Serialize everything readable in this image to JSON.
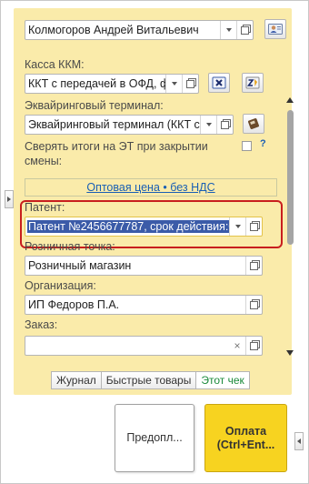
{
  "cashier": {
    "value": "Колмогоров Андрей Витальевич"
  },
  "kkm": {
    "label": "Касса ККМ:",
    "value": "ККТ с передачей в ОФД, фи"
  },
  "acquiring": {
    "label": "Эквайринговый терминал:",
    "value": "Эквайринговый терминал  (ККТ с"
  },
  "reconcile": {
    "label_line1": "Сверять итоги на ЭТ при закрытии",
    "label_line2": "смены:",
    "help": "?"
  },
  "price_link": "Оптовая цена • без НДС",
  "patent": {
    "label": "Патент:",
    "value": "Патент №2456677787, срок действия:0"
  },
  "retail_point": {
    "label": "Розничная точка:",
    "value": "Розничный магазин"
  },
  "organization": {
    "label": "Организация:",
    "value": "ИП Федоров П.А."
  },
  "order": {
    "label": "Заказ:",
    "value": ""
  },
  "tabs": [
    {
      "label": "Журнал"
    },
    {
      "label": "Быстрые товары"
    },
    {
      "label": "Этот чек"
    }
  ],
  "buttons": {
    "prepay": "Предопл...",
    "pay_line1": "Оплата",
    "pay_line2": "(Ctrl+Ent..."
  },
  "colors": {
    "panel_bg": "#faebaa",
    "highlight_border": "#c81e1e",
    "selection_bg": "#3b5ba8",
    "pay_button": "#f7d320",
    "link": "#1a5fb4",
    "active_tab_text": "#1a8a3a"
  }
}
